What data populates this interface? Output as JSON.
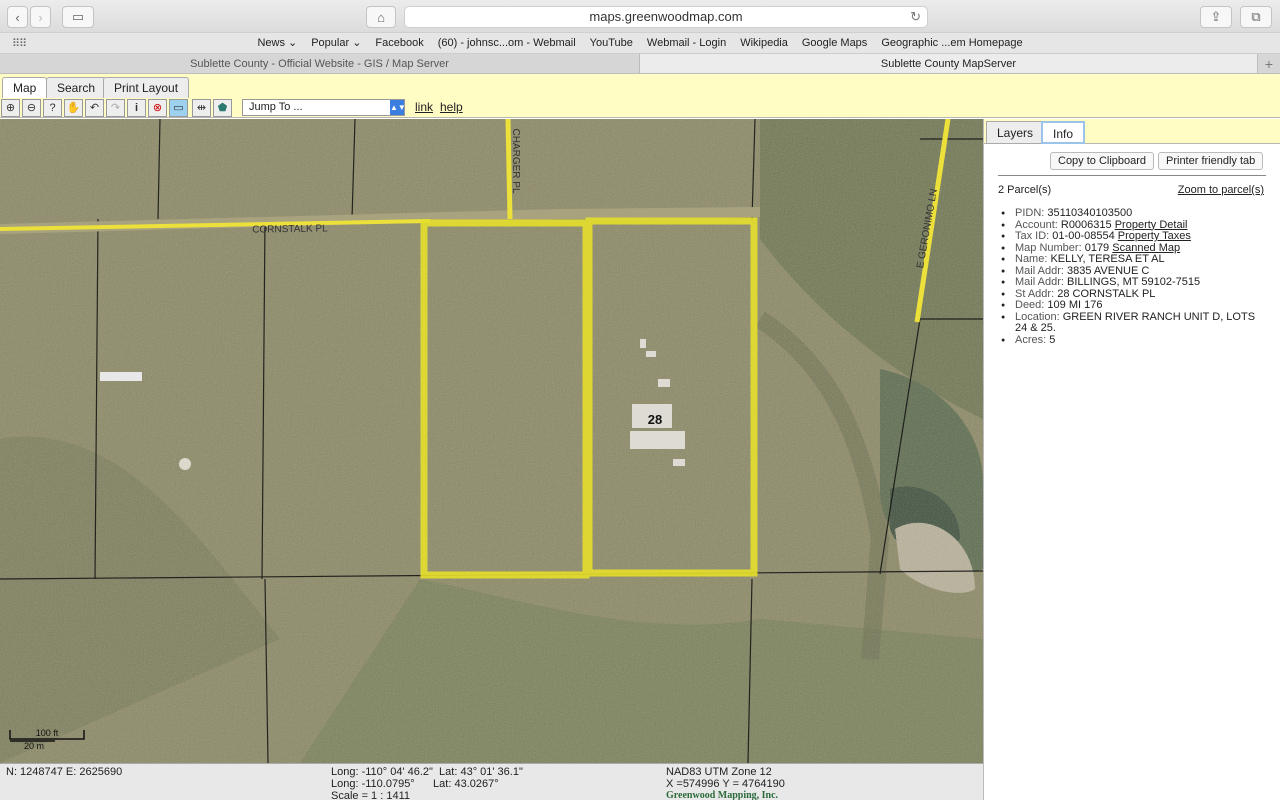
{
  "browser": {
    "url": "maps.greenwoodmap.com",
    "favorites": [
      "News ⌄",
      "Popular ⌄",
      "Facebook",
      "(60) - johnsc...om - Webmail",
      "YouTube",
      "Webmail - Login",
      "Wikipedia",
      "Google Maps",
      "Geographic ...em Homepage"
    ],
    "tabs": [
      "Sublette County - Official Website - GIS / Map Server",
      "Sublette County MapServer"
    ]
  },
  "app": {
    "tabs": [
      "Map",
      "Search",
      "Print Layout"
    ],
    "jump_to": "Jump To ...",
    "link": "link",
    "help": "help"
  },
  "map": {
    "roads": [
      "CORNSTALK PL",
      "CHARGER PL",
      "E GERONIMO LN"
    ],
    "parcel_label": "28",
    "scalebar": [
      "100 ft",
      "20 m"
    ]
  },
  "panel": {
    "tabs": [
      "Layers",
      "Info"
    ],
    "copy_button": "Copy to Clipboard",
    "print_button": "Printer friendly tab",
    "parcel_count": "2 Parcel(s)",
    "zoom_link": "Zoom to parcel(s)",
    "items": [
      {
        "label": "PIDN:",
        "value": "35110340103500",
        "link": ""
      },
      {
        "label": "Account:",
        "value": "R0006315",
        "link": "Property Detail"
      },
      {
        "label": "Tax ID:",
        "value": "01-00-08554",
        "link": "Property Taxes"
      },
      {
        "label": "Map Number:",
        "value": "0179",
        "link": "Scanned Map"
      },
      {
        "label": "Name:",
        "value": "KELLY, TERESA ET AL",
        "link": ""
      },
      {
        "label": "Mail Addr:",
        "value": "3835 AVENUE C",
        "link": ""
      },
      {
        "label": "Mail Addr:",
        "value": "BILLINGS, MT 59102-7515",
        "link": ""
      },
      {
        "label": "St Addr:",
        "value": "28 CORNSTALK PL",
        "link": ""
      },
      {
        "label": "Deed:",
        "value": "109 MI 176",
        "link": ""
      },
      {
        "label": "Location:",
        "value": "GREEN RIVER RANCH UNIT D, LOTS 24 & 25.",
        "link": ""
      },
      {
        "label": "Acres:",
        "value": "5",
        "link": ""
      }
    ]
  },
  "status": {
    "ne": "N: 1248747 E: 2625690",
    "dms": "Long: -110° 04' 46.2\"  Lat: 43° 01' 36.1\"",
    "dec": "Long: -110.0795°      Lat: 43.0267°",
    "scale": "Scale = 1 : 1411",
    "utm_zone": "NAD83 UTM Zone 12",
    "utm": "X =574996 Y = 4764190",
    "credit": "Greenwood Mapping, Inc."
  }
}
